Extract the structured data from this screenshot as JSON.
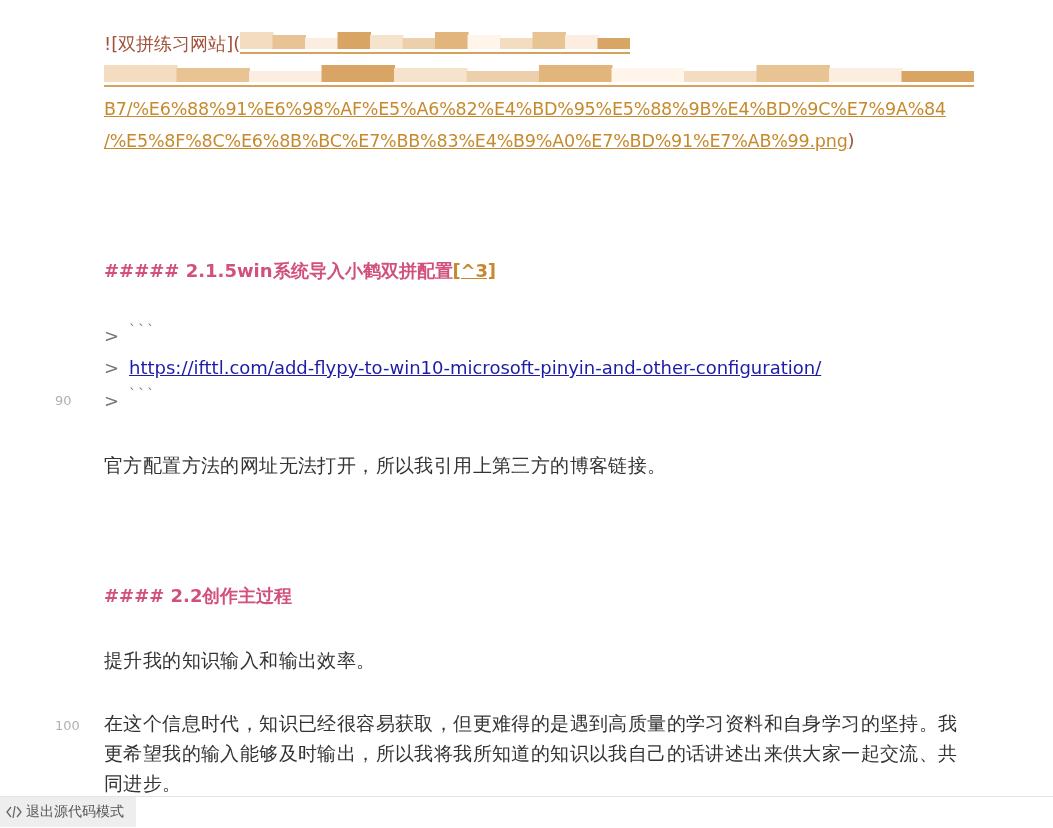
{
  "editor": {
    "lines": [
      {
        "label": "![双拼练习网站](",
        "url_lines": [
          "B7/%E6%88%91%E6%98%AF%E5%A6%82%E4%BD%95%E5%88%9B%E4%BD%9C%E7%9A%84",
          "/%E5%8F%8C%E6%8B%BC%E7%BB%83%E4%B9%A0%E7%BD%91%E7%AB%99.png"
        ],
        "close": ")"
      },
      {
        "kind": "blank"
      },
      {
        "kind": "blank"
      },
      {
        "kind": "blank"
      },
      {
        "kind": "heading",
        "text": "##### 2.1.5win系统导入小鹤双拼配置",
        "footnote": "[^3]"
      },
      {
        "kind": "blank"
      },
      {
        "kind": "quote",
        "marker": ">",
        "text": "```",
        "link": false
      },
      {
        "kind": "quote",
        "marker": ">",
        "text": "https://ifttl.com/add-flypy-to-win10-microsoft-pinyin-and-other-configuration/",
        "link": true
      },
      {
        "kind": "quote",
        "marker": ">",
        "text": "```",
        "link": false,
        "line_number": "90"
      },
      {
        "kind": "blank"
      },
      {
        "kind": "paragraph",
        "text": "官方配置方法的网址无法打开，所以我引用上第三方的博客链接。"
      },
      {
        "kind": "blank"
      },
      {
        "kind": "blank"
      },
      {
        "kind": "blank"
      },
      {
        "kind": "heading",
        "text": "#### 2.2创作主过程"
      },
      {
        "kind": "blank"
      },
      {
        "kind": "paragraph",
        "text": "提升我的知识输入和输出效率。"
      },
      {
        "kind": "blank"
      },
      {
        "kind": "paragraph",
        "text": "在这个信息时代，知识已经很容易获取，但更难得的是遇到高质量的学习资料和自身学习的坚持。我更希望我的输入能够及时输出，所以我将我所知道的知识以我自己的话讲述出来供大家一起交流、共同进步。",
        "line_number": "100"
      }
    ]
  },
  "status_bar": {
    "button": "退出源代码模式"
  }
}
